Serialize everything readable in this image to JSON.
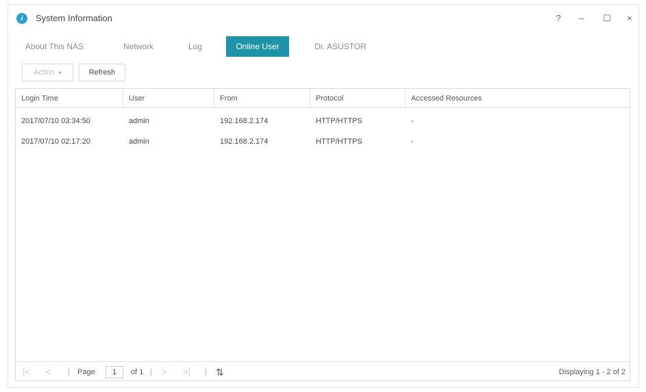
{
  "window": {
    "title": "System Information",
    "info_icon_glyph": "i",
    "controls": {
      "help": "?",
      "minimize": "–",
      "maximize": "☐",
      "close": "×"
    }
  },
  "tabs": [
    {
      "label": "About This NAS",
      "active": false
    },
    {
      "label": "Network",
      "active": false
    },
    {
      "label": "Log",
      "active": false
    },
    {
      "label": "Online User",
      "active": true
    },
    {
      "label": "Dr. ASUSTOR",
      "active": false
    }
  ],
  "toolbar": {
    "action_label": "Action",
    "action_caret": "▾",
    "refresh_label": "Refresh"
  },
  "table": {
    "columns": [
      "Login Time",
      "User",
      "From",
      "Protocol",
      "Accessed Resources"
    ],
    "rows": [
      [
        "2017/07/10 03:34:50",
        "admin",
        "192.168.2.174",
        "HTTP/HTTPS",
        "-"
      ],
      [
        "2017/07/10 02:17:20",
        "admin",
        "192.168.2.174",
        "HTTP/HTTPS",
        "-"
      ]
    ]
  },
  "pager": {
    "first_icon": "|<",
    "prev_icon": "<",
    "page_label": "Page",
    "page_value": "1",
    "of_label": "of 1",
    "next_icon": ">",
    "last_icon": ">|",
    "separator": "|",
    "refresh_icon": "⇅",
    "display_text": "Displaying 1 - 2 of 2"
  },
  "colors": {
    "accent": "#1f93a7",
    "info_icon": "#2a9fd6"
  }
}
